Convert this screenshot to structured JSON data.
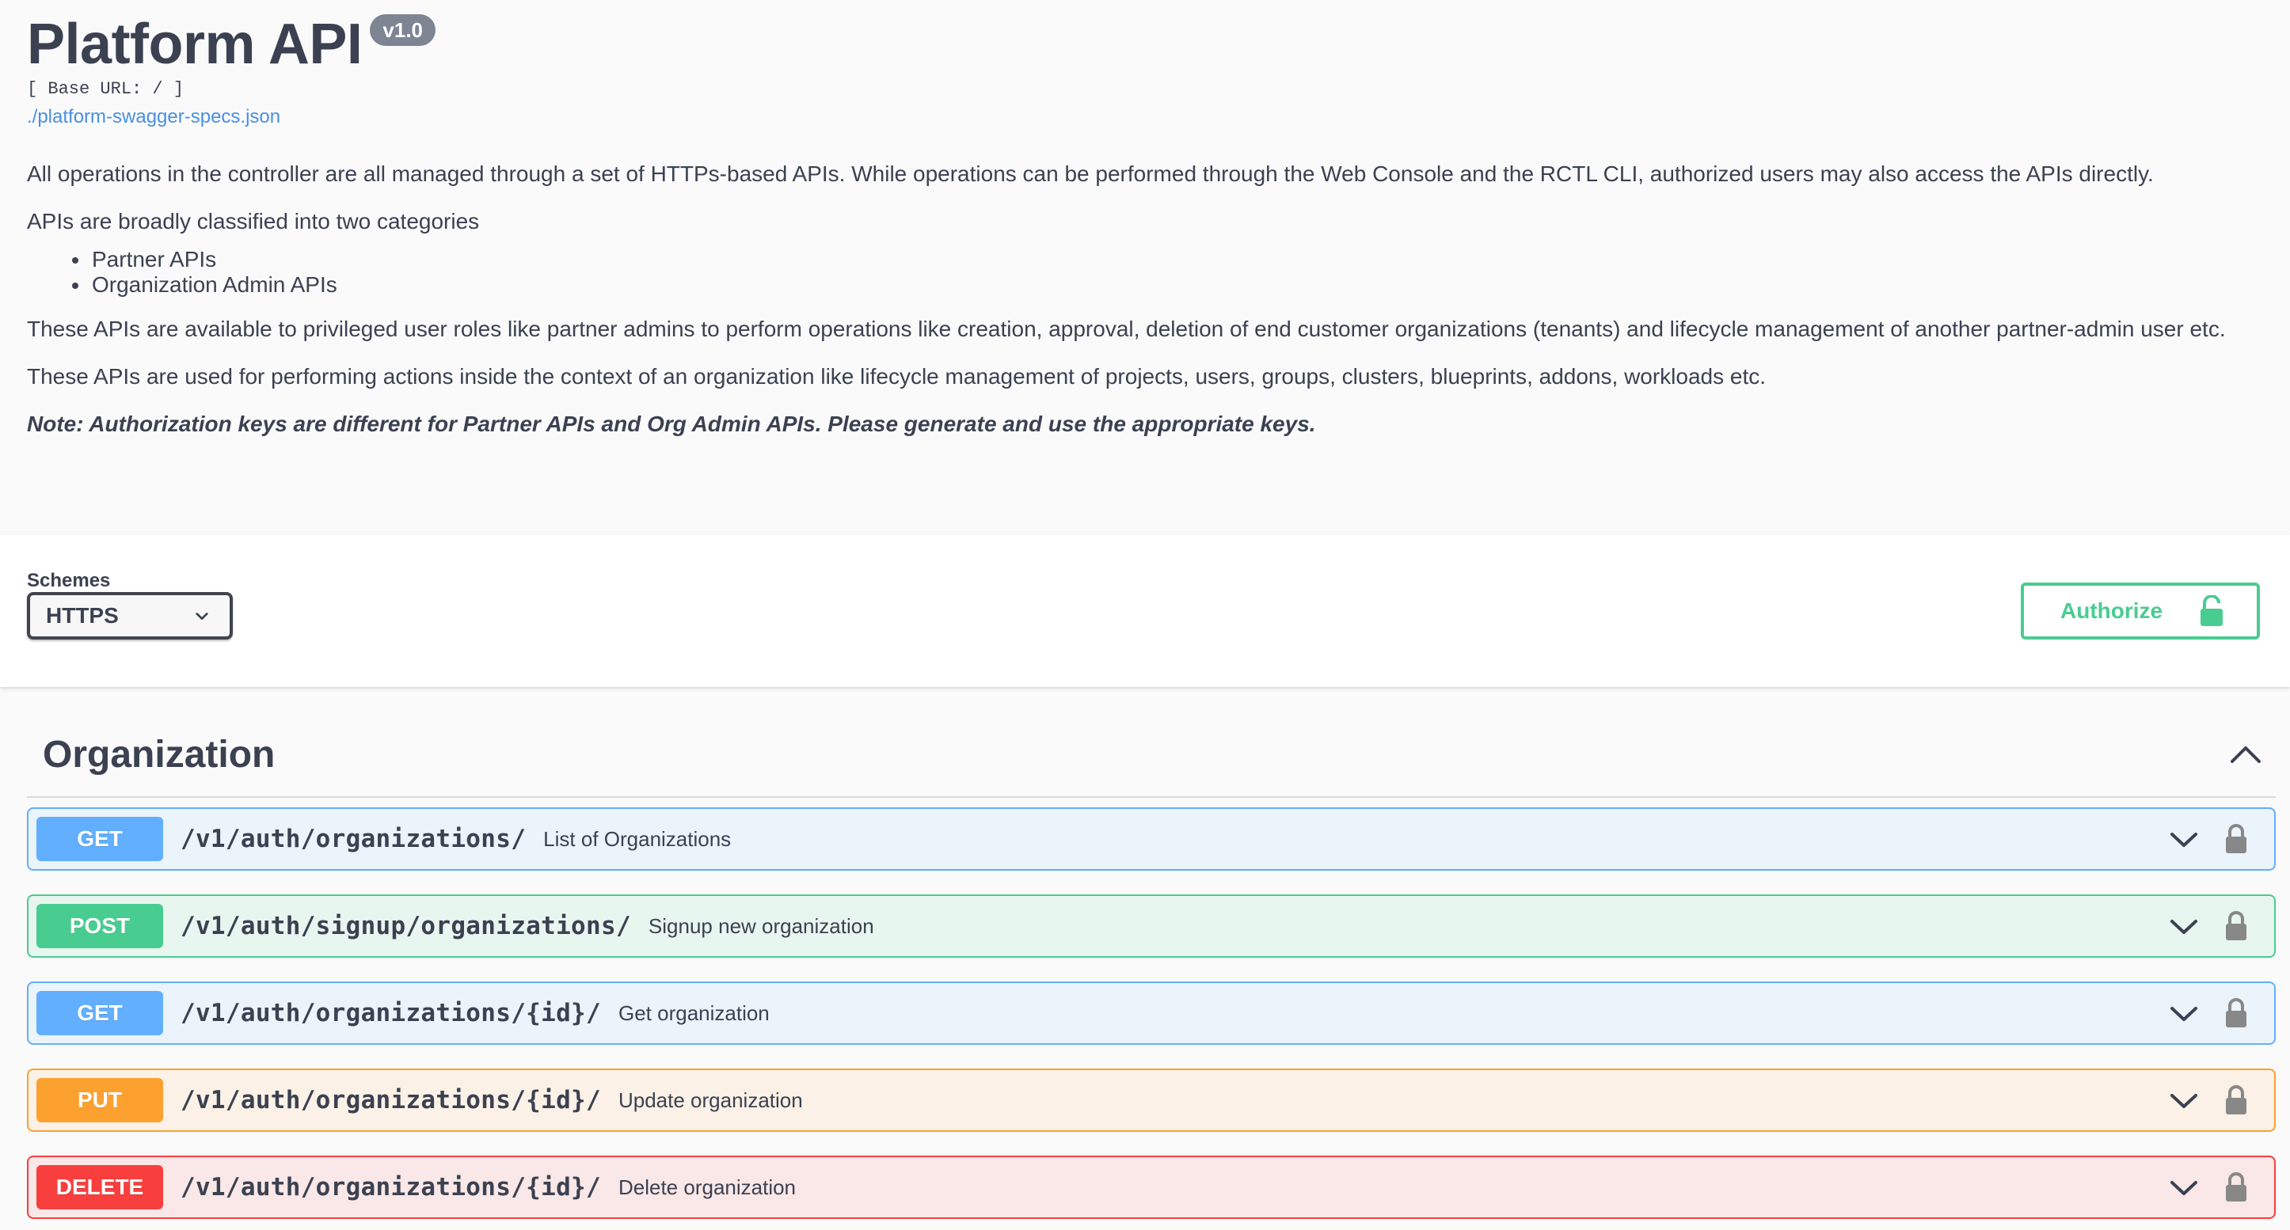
{
  "info": {
    "title": "Platform API",
    "version": "v1.0",
    "base_url": "[ Base URL: / ]",
    "spec_link": "./platform-swagger-specs.json",
    "paragraph_1": "All operations in the controller are all managed through a set of HTTPs-based APIs. While operations can be performed through the Web Console and the RCTL CLI, authorized users may also access the APIs directly.",
    "paragraph_2": "APIs are broadly classified into two categories",
    "categories": [
      "Partner APIs",
      "Organization Admin APIs"
    ],
    "paragraph_3": "These APIs are available to privileged user roles like partner admins to perform operations like creation, approval, deletion of end customer organizations (tenants) and lifecycle management of another partner-admin user etc.",
    "paragraph_4": "These APIs are used for performing actions inside the context of an organization like lifecycle management of projects, users, groups, clusters, blueprints, addons, workloads etc.",
    "note": "Note: Authorization keys are different for Partner APIs and Org Admin APIs. Please generate and use the appropriate keys."
  },
  "schemes": {
    "label": "Schemes",
    "selected": "HTTPS"
  },
  "authorize": {
    "label": "Authorize"
  },
  "tag": {
    "name": "Organization",
    "operations": [
      {
        "method": "GET",
        "path": "/v1/auth/organizations/",
        "summary": "List of Organizations"
      },
      {
        "method": "POST",
        "path": "/v1/auth/signup/organizations/",
        "summary": "Signup new organization"
      },
      {
        "method": "GET",
        "path": "/v1/auth/organizations/{id}/",
        "summary": "Get organization"
      },
      {
        "method": "PUT",
        "path": "/v1/auth/organizations/{id}/",
        "summary": "Update organization"
      },
      {
        "method": "DELETE",
        "path": "/v1/auth/organizations/{id}/",
        "summary": "Delete organization"
      }
    ]
  },
  "colors": {
    "get": "#61affe",
    "post": "#49cc90",
    "put": "#fca130",
    "delete": "#f93e3e",
    "authorize": "#49cc90",
    "version_badge": "#7d8492",
    "link": "#4990e2"
  },
  "icons": {
    "select_chevron": "chevron-down-icon",
    "authorize_lock": "lock-open-icon",
    "tag_toggle": "chevron-up-icon",
    "operation_expand": "chevron-down-icon",
    "operation_lock": "lock-icon"
  }
}
